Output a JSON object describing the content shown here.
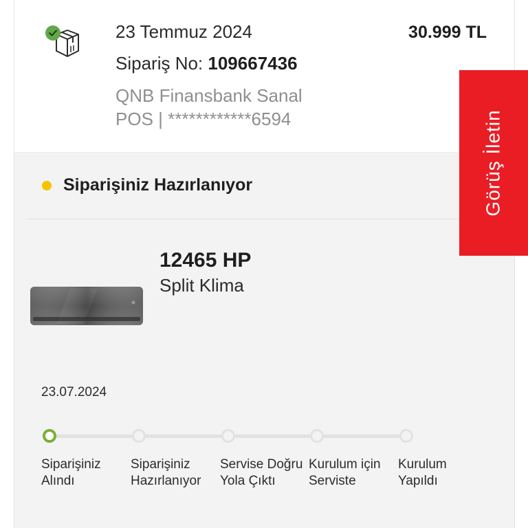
{
  "order": {
    "date": "23 Temmuz 2024",
    "order_no_label": "Sipariş No: ",
    "order_no_value": "109667436",
    "payment_line1": "QNB Finansbank Sanal",
    "payment_line2": "POS | ************6594",
    "price": "30.999 TL",
    "icon": "package-check-icon"
  },
  "status": {
    "text": "Siparişiniz Hazırlanıyor",
    "dot_color": "#f5c400"
  },
  "product": {
    "code": "12465 HP",
    "name": "Split Klima",
    "image": "air-conditioner-image"
  },
  "tracking": {
    "date": "23.07.2024",
    "active_step": 0,
    "steps": [
      {
        "label": "Siparişiniz\nAlındı"
      },
      {
        "label": "Siparişiniz\nHazırlanıyor"
      },
      {
        "label": "Servise Doğru\nYola Çıktı"
      },
      {
        "label": "Kurulum için\nServiste"
      },
      {
        "label": "Kurulum\nYapıldı"
      }
    ]
  },
  "feedback": {
    "label": "Görüş İletin",
    "color": "#ea1d25"
  },
  "colors": {
    "accent_green": "#7ab03a",
    "background_gray": "#f3f3f3"
  }
}
